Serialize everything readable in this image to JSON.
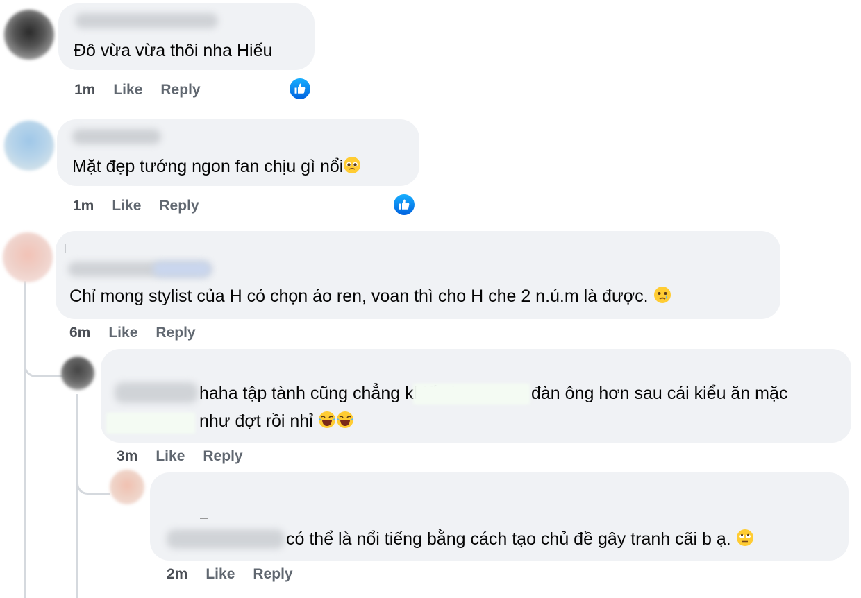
{
  "comments": [
    {
      "text": "Đô vừa vừa thôi nha Hiếu",
      "time": "1m",
      "like": "Like",
      "reply": "Reply"
    },
    {
      "text": "Mặt đẹp tướng ngon fan chịu gì nổi",
      "time": "1m",
      "like": "Like",
      "reply": "Reply"
    },
    {
      "text": "Chỉ mong stylist của H có chọn áo ren, voan thì cho H che 2 n.ú.m là được.",
      "time": "6m",
      "like": "Like",
      "reply": "Reply"
    },
    {
      "line1": "haha tập tành cũng chẳng khiến h",
      "line1b": "đàn ông hơn sau cái kiểu ăn mặc",
      "line2": "như đợt rồi nhỉ",
      "time": "3m",
      "like": "Like",
      "reply": "Reply"
    },
    {
      "text": "có thể là nổi tiếng bằng cách tạo chủ đề gây tranh cãi b ạ.",
      "time": "2m",
      "like": "Like",
      "reply": "Reply"
    }
  ],
  "icons": {
    "like_reaction": "thumbs-up-icon",
    "crying_face": "pleading-face-icon",
    "tears_of_joy": "laughing-crying-icon",
    "eye_roll": "eye-roll-icon"
  },
  "colors": {
    "bubble": "#f0f2f5",
    "like_blue": "#1877f2",
    "meta_gray": "#65676b"
  }
}
